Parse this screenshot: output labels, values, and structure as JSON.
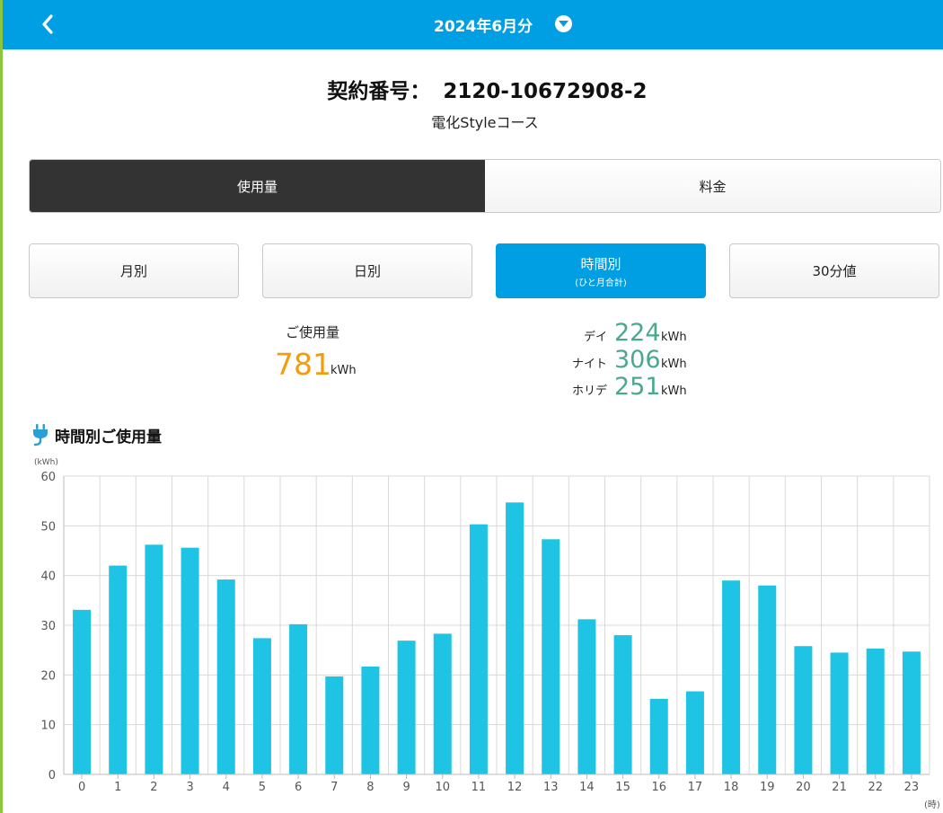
{
  "header": {
    "title": "2024年6月分",
    "back_icon": "chevron-left-icon",
    "dropdown_icon": "chevron-down-circle-icon",
    "bg_color": "#009fe3"
  },
  "contract": {
    "label": "契約番号：",
    "number": "2120-10672908-2",
    "course": "電化Styleコース"
  },
  "mode_tabs": [
    {
      "label": "使用量",
      "active": true
    },
    {
      "label": "料金",
      "active": false
    }
  ],
  "period_tabs": [
    {
      "label": "月別",
      "sub": "",
      "active": false
    },
    {
      "label": "日別",
      "sub": "",
      "active": false
    },
    {
      "label": "時間別",
      "sub": "(ひと月合計)",
      "active": true
    },
    {
      "label": "30分値",
      "sub": "",
      "active": false
    }
  ],
  "usage": {
    "label": "ご使用量",
    "value": "781",
    "unit": "kWh",
    "color": "#f39c12"
  },
  "breakdown": [
    {
      "name": "デイ",
      "value": "224",
      "unit": "kWh"
    },
    {
      "name": "ナイト",
      "value": "306",
      "unit": "kWh"
    },
    {
      "name": "ホリデ",
      "value": "251",
      "unit": "kWh"
    }
  ],
  "chart_section": {
    "title": "時間別ご使用量",
    "icon": "plug-icon"
  },
  "chart_data": {
    "type": "bar",
    "categories": [
      "0",
      "1",
      "2",
      "3",
      "4",
      "5",
      "6",
      "7",
      "8",
      "9",
      "10",
      "11",
      "12",
      "13",
      "14",
      "15",
      "16",
      "17",
      "18",
      "19",
      "20",
      "21",
      "22",
      "23"
    ],
    "values": [
      33.1,
      42.0,
      46.2,
      45.6,
      39.2,
      27.4,
      30.2,
      19.7,
      21.7,
      26.9,
      28.3,
      50.3,
      54.7,
      47.3,
      31.2,
      28.0,
      15.2,
      16.7,
      39.0,
      38.0,
      25.8,
      24.5,
      25.3,
      24.7
    ],
    "ylabel": "(kWh)",
    "xlabel": "(時)",
    "ylim": [
      0,
      60
    ],
    "yticks": [
      0,
      10,
      20,
      30,
      40,
      50,
      60
    ],
    "grid": true,
    "bar_color": "#1fc3e3"
  }
}
